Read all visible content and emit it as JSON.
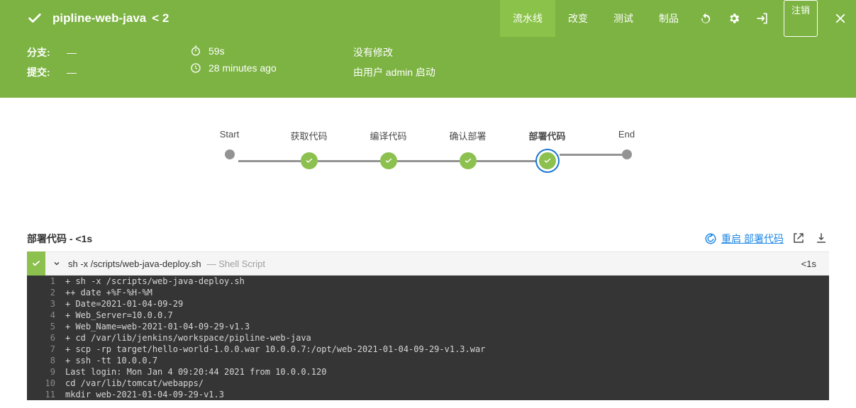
{
  "header": {
    "title": "pipline-web-java",
    "run_number": "< 2",
    "tabs": [
      "流水线",
      "改变",
      "测试",
      "制品"
    ],
    "active_tab": 0,
    "logout": "注销"
  },
  "info": {
    "branch_label": "分支:",
    "branch_value": "—",
    "commit_label": "提交:",
    "commit_value": "—",
    "duration": "59s",
    "relative_time": "28 minutes ago",
    "changes_text": "没有修改",
    "cause_text": "由用户 admin 启动"
  },
  "stages": [
    {
      "label": "Start",
      "kind": "grey"
    },
    {
      "label": "获取代码",
      "kind": "green"
    },
    {
      "label": "编译代码",
      "kind": "green"
    },
    {
      "label": "确认部署",
      "kind": "green"
    },
    {
      "label": "部署代码",
      "kind": "green",
      "selected": true
    },
    {
      "label": "End",
      "kind": "grey"
    }
  ],
  "section": {
    "title": "部署代码 - <1s",
    "restart_label": "重启 部署代码"
  },
  "step": {
    "cmd": "sh -x /scripts/web-java-deploy.sh",
    "desc": "— Shell Script",
    "time": "<1s"
  },
  "console_lines": [
    "+ sh -x /scripts/web-java-deploy.sh",
    "++ date +%F-%H-%M",
    "+ Date=2021-01-04-09-29",
    "+ Web_Server=10.0.0.7",
    "+ Web_Name=web-2021-01-04-09-29-v1.3",
    "+ cd /var/lib/jenkins/workspace/pipline-web-java",
    "+ scp -rp target/hello-world-1.0.0.war 10.0.0.7:/opt/web-2021-01-04-09-29-v1.3.war",
    "+ ssh -tt 10.0.0.7",
    "Last login: Mon Jan  4 09:20:44 2021 from 10.0.0.120",
    "cd /var/lib/tomcat/webapps/",
    "mkdir web-2021-01-04-09-29-v1.3"
  ]
}
